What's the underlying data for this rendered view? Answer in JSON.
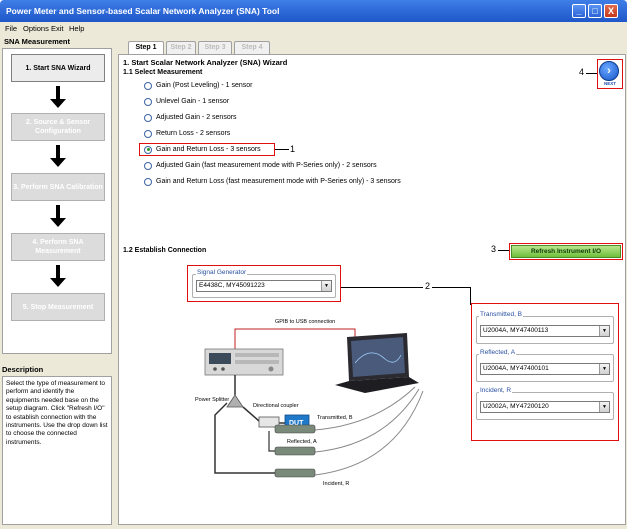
{
  "window": {
    "title": "Power Meter and Sensor-based Scalar Network Analyzer (SNA) Tool",
    "min_label": "_",
    "max_label": "□",
    "close_label": "X"
  },
  "menu": {
    "items": [
      "File",
      "Options",
      "Exit",
      "Help"
    ]
  },
  "left_panel": {
    "heading": "SNA Measurement",
    "steps": [
      {
        "label": "1. Start SNA Wizard",
        "active": true
      },
      {
        "label": "2. Source & Sensor Configuration",
        "active": false
      },
      {
        "label": "3. Perform SNA Calibration",
        "active": false
      },
      {
        "label": "4. Perform SNA Measurement",
        "active": false
      },
      {
        "label": "5. Stop Measurement",
        "active": false
      }
    ],
    "description_heading": "Description",
    "description_text": "Select the type of measurement to perform and identify the equipments needed base on the setup diagram. Click \"Refresh I/O\" to establish connection with the instruments. Use the drop down list to choose the connected instruments."
  },
  "tabs": [
    {
      "label": "Step 1",
      "active": true
    },
    {
      "label": "Step 2",
      "active": false
    },
    {
      "label": "Step 3",
      "active": false
    },
    {
      "label": "Step 4",
      "active": false
    }
  ],
  "wizard": {
    "title": "1. Start Scalar Network Analyzer (SNA) Wizard",
    "select_heading": "1.1 Select Measurement",
    "options": [
      {
        "label": "Gain (Post Leveling) - 1 sensor",
        "checked": false
      },
      {
        "label": "Unlevel Gain - 1 sensor",
        "checked": false
      },
      {
        "label": "Adjusted Gain - 2 sensors",
        "checked": false
      },
      {
        "label": "Return Loss - 2 sensors",
        "checked": false
      },
      {
        "label": "Gain and Return Loss - 3 sensors",
        "checked": true
      },
      {
        "label": "Adjusted Gain (fast measurement mode with P-Series only) - 2 sensors",
        "checked": false
      },
      {
        "label": "Gain and Return Loss (fast measurement mode with P-Series only) - 3 sensors",
        "checked": false
      }
    ],
    "connection_heading": "1.2 Establish Connection",
    "next_label": "NEXT",
    "next_glyph": "›",
    "refresh_label": "Refresh Instrument I/O",
    "signal_generator": {
      "label": "Signal Generator",
      "value": "E4438C, MY45091223"
    },
    "sensors": [
      {
        "label": "Transmitted, B",
        "value": "U2004A, MY47400113"
      },
      {
        "label": "Reflected, A",
        "value": "U2004A, MY47400101"
      },
      {
        "label": "Incident, R",
        "value": "U2002A, MY47200120"
      }
    ],
    "callouts": [
      "1",
      "2",
      "3",
      "4"
    ],
    "dropdown_glyph": "▼"
  },
  "diagram": {
    "gpib_label": "GPIB to USB connection",
    "power_splitter_label": "Power Splitter",
    "directional_coupler_label": "Directional coupler",
    "dut_label": "DUT",
    "transmitted_label": "Transmitted, B",
    "reflected_label": "Reflected, A",
    "incident_label": "Incident, R"
  },
  "colors": {
    "title_bar": "#2a63d6",
    "highlight_red": "#e01010",
    "refresh_green": "#6fbf3a",
    "dut_blue": "#1f78c8"
  }
}
